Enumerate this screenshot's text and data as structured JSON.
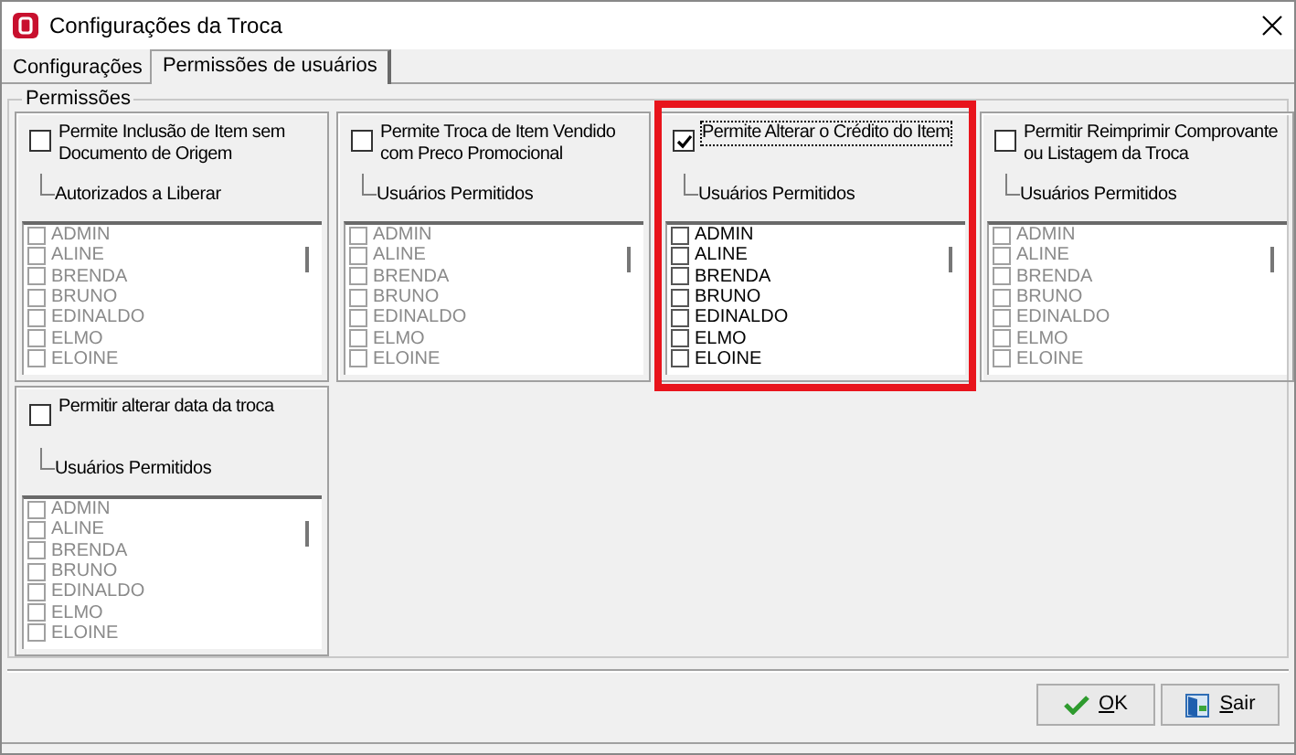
{
  "window": {
    "title": "Configurações da Troca"
  },
  "tabs": [
    {
      "label": "Configurações",
      "selected": false
    },
    {
      "label": "Permissões de usuários",
      "selected": true
    }
  ],
  "group": {
    "title": "Permissões"
  },
  "panels": [
    {
      "label": "Permite Inclusão de Item sem Documento de Origem",
      "checked": false,
      "focused": false,
      "highlighted": false,
      "sublabel": "Autorizados a Liberar",
      "users": [
        {
          "name": "ADMIN",
          "checked": false
        },
        {
          "name": "ALINE",
          "checked": false
        },
        {
          "name": "BRENDA",
          "checked": false
        },
        {
          "name": "BRUNO",
          "checked": false
        },
        {
          "name": "EDINALDO",
          "checked": false
        },
        {
          "name": "ELMO",
          "checked": false
        },
        {
          "name": "ELOINE",
          "checked": false
        }
      ]
    },
    {
      "label": "Permite Troca de Item Vendido com Preco Promocional",
      "checked": false,
      "focused": false,
      "highlighted": false,
      "sublabel": "Usuários Permitidos",
      "users": [
        {
          "name": "ADMIN",
          "checked": false
        },
        {
          "name": "ALINE",
          "checked": false
        },
        {
          "name": "BRENDA",
          "checked": false
        },
        {
          "name": "BRUNO",
          "checked": false
        },
        {
          "name": "EDINALDO",
          "checked": false
        },
        {
          "name": "ELMO",
          "checked": false
        },
        {
          "name": "ELOINE",
          "checked": false
        }
      ]
    },
    {
      "label": "Permite Alterar o Crédito do Item",
      "checked": true,
      "focused": true,
      "highlighted": true,
      "sublabel": "Usuários Permitidos",
      "users": [
        {
          "name": "ADMIN",
          "checked": false
        },
        {
          "name": "ALINE",
          "checked": false
        },
        {
          "name": "BRENDA",
          "checked": false
        },
        {
          "name": "BRUNO",
          "checked": false
        },
        {
          "name": "EDINALDO",
          "checked": false
        },
        {
          "name": "ELMO",
          "checked": false
        },
        {
          "name": "ELOINE",
          "checked": false
        }
      ]
    },
    {
      "label": "Permitir Reimprimir Comprovante ou Listagem da Troca",
      "checked": false,
      "focused": false,
      "highlighted": false,
      "sublabel": "Usuários Permitidos",
      "users": [
        {
          "name": "ADMIN",
          "checked": false
        },
        {
          "name": "ALINE",
          "checked": false
        },
        {
          "name": "BRENDA",
          "checked": false
        },
        {
          "name": "BRUNO",
          "checked": false
        },
        {
          "name": "EDINALDO",
          "checked": false
        },
        {
          "name": "ELMO",
          "checked": false
        },
        {
          "name": "ELOINE",
          "checked": false
        }
      ]
    },
    {
      "label": "Permitir alterar data da troca",
      "checked": false,
      "focused": false,
      "highlighted": false,
      "sublabel": "Usuários Permitidos",
      "users": [
        {
          "name": "ADMIN",
          "checked": false
        },
        {
          "name": "ALINE",
          "checked": false
        },
        {
          "name": "BRENDA",
          "checked": false
        },
        {
          "name": "BRUNO",
          "checked": false
        },
        {
          "name": "EDINALDO",
          "checked": false
        },
        {
          "name": "ELMO",
          "checked": false
        },
        {
          "name": "ELOINE",
          "checked": false
        }
      ]
    }
  ],
  "buttons": [
    {
      "kind": "ok",
      "label": "OK"
    },
    {
      "kind": "exit",
      "label": "Sair"
    }
  ]
}
